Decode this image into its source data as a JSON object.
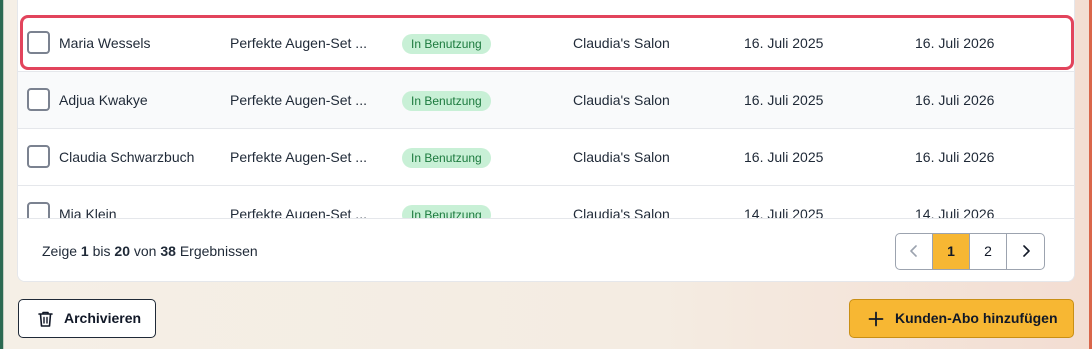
{
  "rows": [
    {
      "name": "Maria Wessels",
      "product": "Perfekte Augen-Set ...",
      "status": "In Benutzung",
      "salon": "Claudia's Salon",
      "start": "16. Juli 2025",
      "end": "16. Juli 2026"
    },
    {
      "name": "Adjua Kwakye",
      "product": "Perfekte Augen-Set ...",
      "status": "In Benutzung",
      "salon": "Claudia's Salon",
      "start": "16. Juli 2025",
      "end": "16. Juli 2026"
    },
    {
      "name": "Claudia Schwarzbuch",
      "product": "Perfekte Augen-Set ...",
      "status": "In Benutzung",
      "salon": "Claudia's Salon",
      "start": "16. Juli 2025",
      "end": "16. Juli 2026"
    },
    {
      "name": "Mia Klein",
      "product": "Perfekte Augen-Set ...",
      "status": "In Benutzung",
      "salon": "Claudia's Salon",
      "start": "14. Juli 2025",
      "end": "14. Juli 2026"
    }
  ],
  "pagination": {
    "prefix": "Zeige",
    "from": "1",
    "to_word": "bis",
    "to": "20",
    "of_word": "von",
    "total": "38",
    "suffix": "Ergebnissen",
    "pages": [
      "1",
      "2"
    ],
    "current_page": "1"
  },
  "actions": {
    "archive_label": "Archivieren",
    "add_label": "Kunden-Abo hinzufügen"
  },
  "colors": {
    "accent": "#f7b733",
    "highlight": "#e2445c",
    "badge_bg": "#c8f0d6",
    "badge_text": "#1c7a3e"
  }
}
